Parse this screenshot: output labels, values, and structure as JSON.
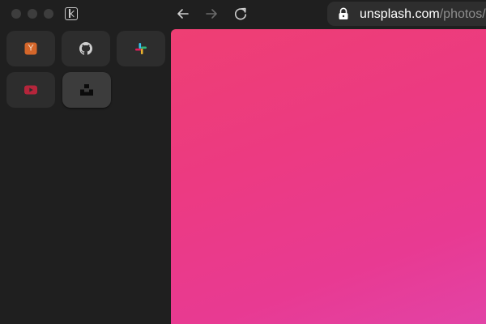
{
  "window": {
    "traffic_lights": [
      "close",
      "minimize",
      "zoom"
    ],
    "sidebar_toggle_icon": "sidebar-toggle-icon"
  },
  "toolbar": {
    "back_icon": "arrow-left-icon",
    "forward_icon": "arrow-right-icon",
    "reload_icon": "reload-icon"
  },
  "urlbar": {
    "lock_icon": "lock-icon",
    "host": "unsplash.com",
    "path": "/photos/pi"
  },
  "sidebar": {
    "pinned": [
      {
        "id": "ycombinator",
        "icon": "y-combinator-icon",
        "letter": "Y",
        "color": "#d4662a",
        "active": false
      },
      {
        "id": "github",
        "icon": "github-icon",
        "color": "#d0d0d0",
        "active": false
      },
      {
        "id": "slack",
        "icon": "slack-icon",
        "active": false
      },
      {
        "id": "youtube",
        "icon": "youtube-icon",
        "color": "#b5253b",
        "active": false
      },
      {
        "id": "unsplash",
        "icon": "unsplash-icon",
        "color": "#0b0b0b",
        "active": true
      }
    ]
  },
  "content": {
    "gradient_colors": [
      "#ee3f73",
      "#ec3a82",
      "#e83a92",
      "#e243a6"
    ]
  }
}
